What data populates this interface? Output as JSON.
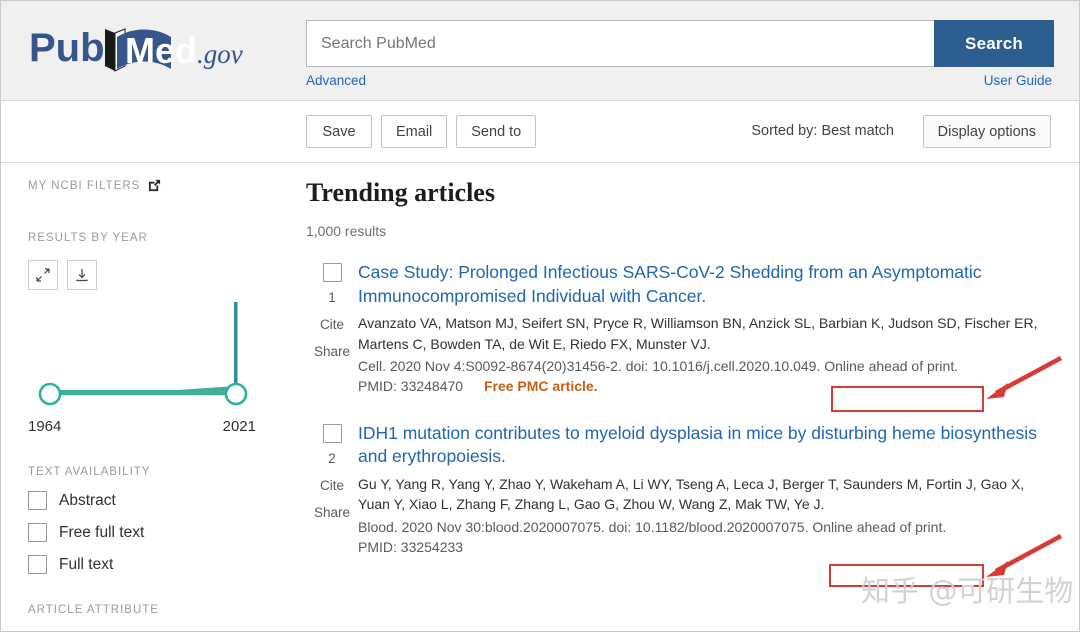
{
  "header": {
    "logo_text": "PubMed.gov",
    "search": {
      "placeholder": "Search PubMed",
      "value": "",
      "button_label": "Search"
    },
    "advanced_label": "Advanced",
    "user_guide_label": "User Guide"
  },
  "actionbar": {
    "save_label": "Save",
    "email_label": "Email",
    "send_to_label": "Send to",
    "sorted_by_label": "Sorted by: Best match",
    "display_options_label": "Display options"
  },
  "sidebar": {
    "my_ncbi_filters_label": "MY NCBI FILTERS",
    "results_by_year_label": "RESULTS BY YEAR",
    "expand_tool_name": "expand-icon",
    "download_tool_name": "download-icon",
    "year_min": "1964",
    "year_max": "2021",
    "text_availability_label": "TEXT AVAILABILITY",
    "text_availability_options": [
      {
        "label": "Abstract",
        "checked": false
      },
      {
        "label": "Free full text",
        "checked": false
      },
      {
        "label": "Full text",
        "checked": false
      }
    ],
    "article_attribute_label": "ARTICLE ATTRIBUTE"
  },
  "main": {
    "page_title": "Trending articles",
    "result_count": "1,000 results",
    "cite_label": "Cite",
    "share_label": "Share",
    "articles": [
      {
        "number": "1",
        "title": "Case Study: Prolonged Infectious SARS-CoV-2 Shedding from an Asymptomatic Immunocompromised Individual with Cancer.",
        "authors": "Avanzato VA, Matson MJ, Seifert SN, Pryce R, Williamson BN, Anzick SL, Barbian K, Judson SD, Fischer ER, Martens C, Bowden TA, de Wit E, Riedo FX, Munster VJ.",
        "citation": "Cell. 2020 Nov 4:S0092-8674(20)31456-2. doi: 10.1016/j.cell.2020.10.049.",
        "ahead_of_print": "Online ahead of print.",
        "pmid": "PMID: 33248470",
        "free_badge": "Free PMC article."
      },
      {
        "number": "2",
        "title": "IDH1 mutation contributes to myeloid dysplasia in mice by disturbing heme biosynthesis and erythropoiesis.",
        "authors": "Gu Y, Yang R, Yang Y, Zhao Y, Wakeham A, Li WY, Tseng A, Leca J, Berger T, Saunders M, Fortin J, Gao X, Yuan Y, Xiao L, Zhang F, Zhang L, Gao G, Zhou W, Wang Z, Mak TW, Ye J.",
        "citation": "Blood. 2020 Nov 30:blood.2020007075. doi: 10.1182/blood.2020007075.",
        "ahead_of_print": "Online ahead of print.",
        "pmid": "PMID: 33254233",
        "free_badge": ""
      }
    ]
  },
  "annotations": {
    "highlight_color": "#d63b35",
    "watermark_text": "知乎 @可研生物"
  },
  "colors": {
    "brand_blue": "#2c5d8f",
    "link_blue": "#2067b0",
    "teal": "#1aa890",
    "orange": "#c4601a"
  }
}
